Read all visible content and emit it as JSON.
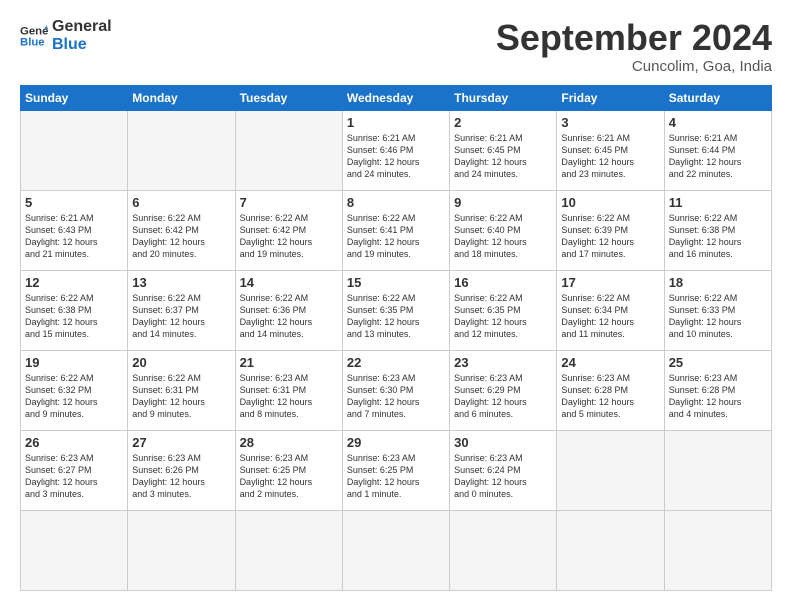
{
  "header": {
    "logo_line1": "General",
    "logo_line2": "Blue",
    "month_title": "September 2024",
    "location": "Cuncolim, Goa, India"
  },
  "weekdays": [
    "Sunday",
    "Monday",
    "Tuesday",
    "Wednesday",
    "Thursday",
    "Friday",
    "Saturday"
  ],
  "days": [
    {
      "num": "",
      "info": ""
    },
    {
      "num": "",
      "info": ""
    },
    {
      "num": "",
      "info": ""
    },
    {
      "num": "1",
      "info": "Sunrise: 6:21 AM\nSunset: 6:46 PM\nDaylight: 12 hours\nand 24 minutes."
    },
    {
      "num": "2",
      "info": "Sunrise: 6:21 AM\nSunset: 6:45 PM\nDaylight: 12 hours\nand 24 minutes."
    },
    {
      "num": "3",
      "info": "Sunrise: 6:21 AM\nSunset: 6:45 PM\nDaylight: 12 hours\nand 23 minutes."
    },
    {
      "num": "4",
      "info": "Sunrise: 6:21 AM\nSunset: 6:44 PM\nDaylight: 12 hours\nand 22 minutes."
    },
    {
      "num": "5",
      "info": "Sunrise: 6:21 AM\nSunset: 6:43 PM\nDaylight: 12 hours\nand 21 minutes."
    },
    {
      "num": "6",
      "info": "Sunrise: 6:22 AM\nSunset: 6:42 PM\nDaylight: 12 hours\nand 20 minutes."
    },
    {
      "num": "7",
      "info": "Sunrise: 6:22 AM\nSunset: 6:42 PM\nDaylight: 12 hours\nand 19 minutes."
    },
    {
      "num": "8",
      "info": "Sunrise: 6:22 AM\nSunset: 6:41 PM\nDaylight: 12 hours\nand 19 minutes."
    },
    {
      "num": "9",
      "info": "Sunrise: 6:22 AM\nSunset: 6:40 PM\nDaylight: 12 hours\nand 18 minutes."
    },
    {
      "num": "10",
      "info": "Sunrise: 6:22 AM\nSunset: 6:39 PM\nDaylight: 12 hours\nand 17 minutes."
    },
    {
      "num": "11",
      "info": "Sunrise: 6:22 AM\nSunset: 6:38 PM\nDaylight: 12 hours\nand 16 minutes."
    },
    {
      "num": "12",
      "info": "Sunrise: 6:22 AM\nSunset: 6:38 PM\nDaylight: 12 hours\nand 15 minutes."
    },
    {
      "num": "13",
      "info": "Sunrise: 6:22 AM\nSunset: 6:37 PM\nDaylight: 12 hours\nand 14 minutes."
    },
    {
      "num": "14",
      "info": "Sunrise: 6:22 AM\nSunset: 6:36 PM\nDaylight: 12 hours\nand 14 minutes."
    },
    {
      "num": "15",
      "info": "Sunrise: 6:22 AM\nSunset: 6:35 PM\nDaylight: 12 hours\nand 13 minutes."
    },
    {
      "num": "16",
      "info": "Sunrise: 6:22 AM\nSunset: 6:35 PM\nDaylight: 12 hours\nand 12 minutes."
    },
    {
      "num": "17",
      "info": "Sunrise: 6:22 AM\nSunset: 6:34 PM\nDaylight: 12 hours\nand 11 minutes."
    },
    {
      "num": "18",
      "info": "Sunrise: 6:22 AM\nSunset: 6:33 PM\nDaylight: 12 hours\nand 10 minutes."
    },
    {
      "num": "19",
      "info": "Sunrise: 6:22 AM\nSunset: 6:32 PM\nDaylight: 12 hours\nand 9 minutes."
    },
    {
      "num": "20",
      "info": "Sunrise: 6:22 AM\nSunset: 6:31 PM\nDaylight: 12 hours\nand 9 minutes."
    },
    {
      "num": "21",
      "info": "Sunrise: 6:23 AM\nSunset: 6:31 PM\nDaylight: 12 hours\nand 8 minutes."
    },
    {
      "num": "22",
      "info": "Sunrise: 6:23 AM\nSunset: 6:30 PM\nDaylight: 12 hours\nand 7 minutes."
    },
    {
      "num": "23",
      "info": "Sunrise: 6:23 AM\nSunset: 6:29 PM\nDaylight: 12 hours\nand 6 minutes."
    },
    {
      "num": "24",
      "info": "Sunrise: 6:23 AM\nSunset: 6:28 PM\nDaylight: 12 hours\nand 5 minutes."
    },
    {
      "num": "25",
      "info": "Sunrise: 6:23 AM\nSunset: 6:28 PM\nDaylight: 12 hours\nand 4 minutes."
    },
    {
      "num": "26",
      "info": "Sunrise: 6:23 AM\nSunset: 6:27 PM\nDaylight: 12 hours\nand 3 minutes."
    },
    {
      "num": "27",
      "info": "Sunrise: 6:23 AM\nSunset: 6:26 PM\nDaylight: 12 hours\nand 3 minutes."
    },
    {
      "num": "28",
      "info": "Sunrise: 6:23 AM\nSunset: 6:25 PM\nDaylight: 12 hours\nand 2 minutes."
    },
    {
      "num": "29",
      "info": "Sunrise: 6:23 AM\nSunset: 6:25 PM\nDaylight: 12 hours\nand 1 minute."
    },
    {
      "num": "30",
      "info": "Sunrise: 6:23 AM\nSunset: 6:24 PM\nDaylight: 12 hours\nand 0 minutes."
    },
    {
      "num": "",
      "info": ""
    },
    {
      "num": "",
      "info": ""
    },
    {
      "num": "",
      "info": ""
    },
    {
      "num": "",
      "info": ""
    },
    {
      "num": "",
      "info": ""
    }
  ]
}
